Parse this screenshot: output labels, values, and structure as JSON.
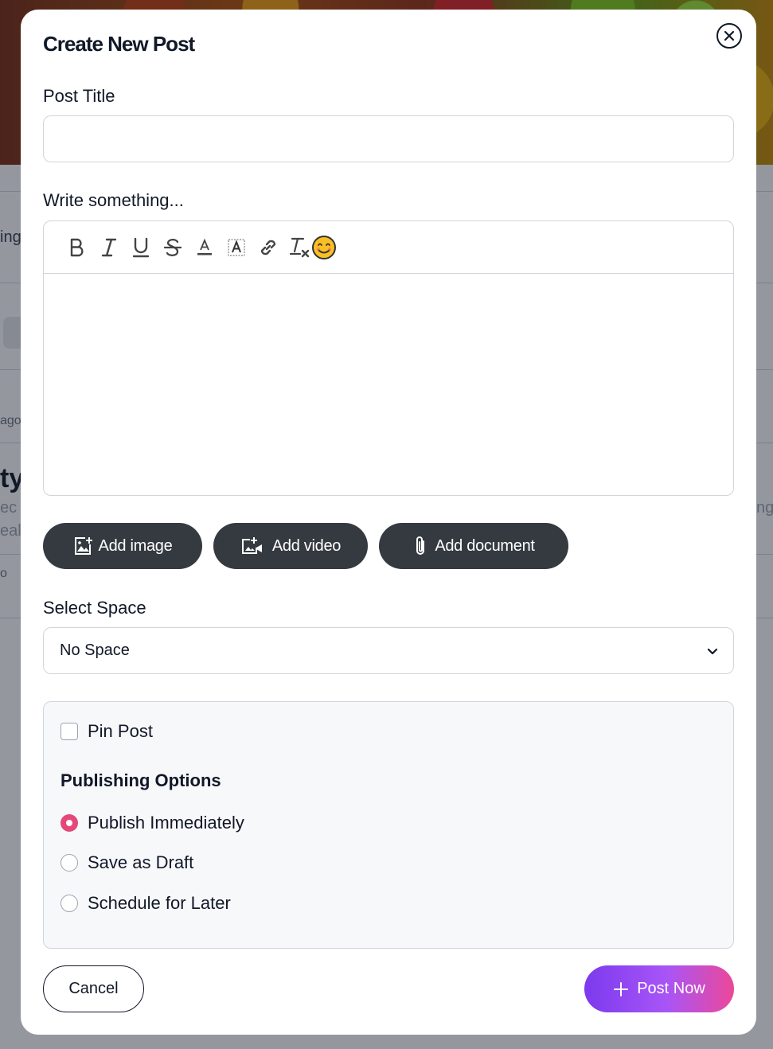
{
  "background": {
    "fragments": [
      "ing",
      "ago",
      "ty",
      "ec",
      "eal",
      "ng",
      "o"
    ]
  },
  "modal": {
    "title": "Create New Post",
    "close_icon": "close-circle-icon"
  },
  "post_title": {
    "label": "Post Title",
    "value": "",
    "placeholder": ""
  },
  "editor": {
    "label": "Write something...",
    "toolbar": [
      "bold-icon",
      "italic-icon",
      "underline-icon",
      "strikethrough-icon",
      "text-color-icon",
      "highlight-icon",
      "link-icon",
      "clear-format-icon",
      "emoji-icon"
    ],
    "content": ""
  },
  "attachments": {
    "add_image": "Add image",
    "add_video": "Add video",
    "add_document": "Add document"
  },
  "space": {
    "label": "Select Space",
    "selected": "No Space"
  },
  "options": {
    "pin_post": "Pin Post",
    "pin_checked": false,
    "publishing_title": "Publishing Options",
    "publish_immediately": "Publish Immediately",
    "save_as_draft": "Save as Draft",
    "schedule_for_later": "Schedule for Later",
    "selected": "Publish Immediately"
  },
  "actions": {
    "cancel": "Cancel",
    "post_now": "Post Now"
  },
  "colors": {
    "accent_pink": "#e5477a",
    "button_dark": "#343a40",
    "gradient_start": "#7c3aed",
    "gradient_end": "#ec4899"
  }
}
